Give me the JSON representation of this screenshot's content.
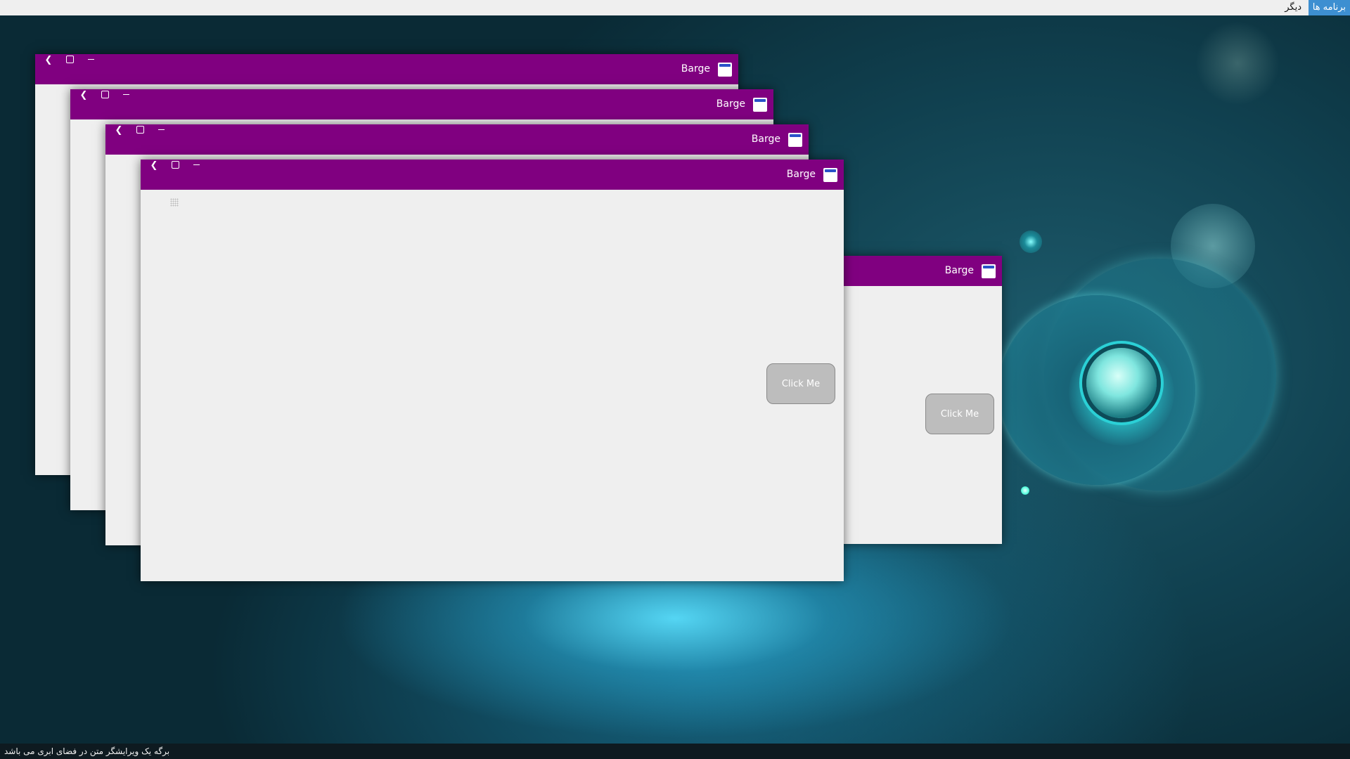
{
  "top_panel": {
    "apps_menu_label": "برنامه ها",
    "other_menu_label": "دیگر"
  },
  "status_bar": {
    "text": "برگه یک ویرایشگر متن در فضای ابری می باشد"
  },
  "windows": [
    {
      "title": "Barge",
      "controls": [
        "back-icon",
        "maximize-icon",
        "minimize-icon"
      ]
    },
    {
      "title": "Barge",
      "controls": [
        "back-icon",
        "maximize-icon",
        "minimize-icon"
      ]
    },
    {
      "title": "Barge",
      "controls": [
        "back-icon",
        "maximize-icon",
        "minimize-icon"
      ]
    },
    {
      "title": "Barge",
      "controls": [
        "back-icon",
        "maximize-icon",
        "minimize-icon"
      ],
      "button_label": "Click Me"
    },
    {
      "title": "Barge",
      "button_label": "Click Me"
    }
  ],
  "colors": {
    "titlebar": "#800080",
    "apps_menu": "#3d8fd1",
    "window_body": "#efefef",
    "button": "#bdbdbd"
  }
}
